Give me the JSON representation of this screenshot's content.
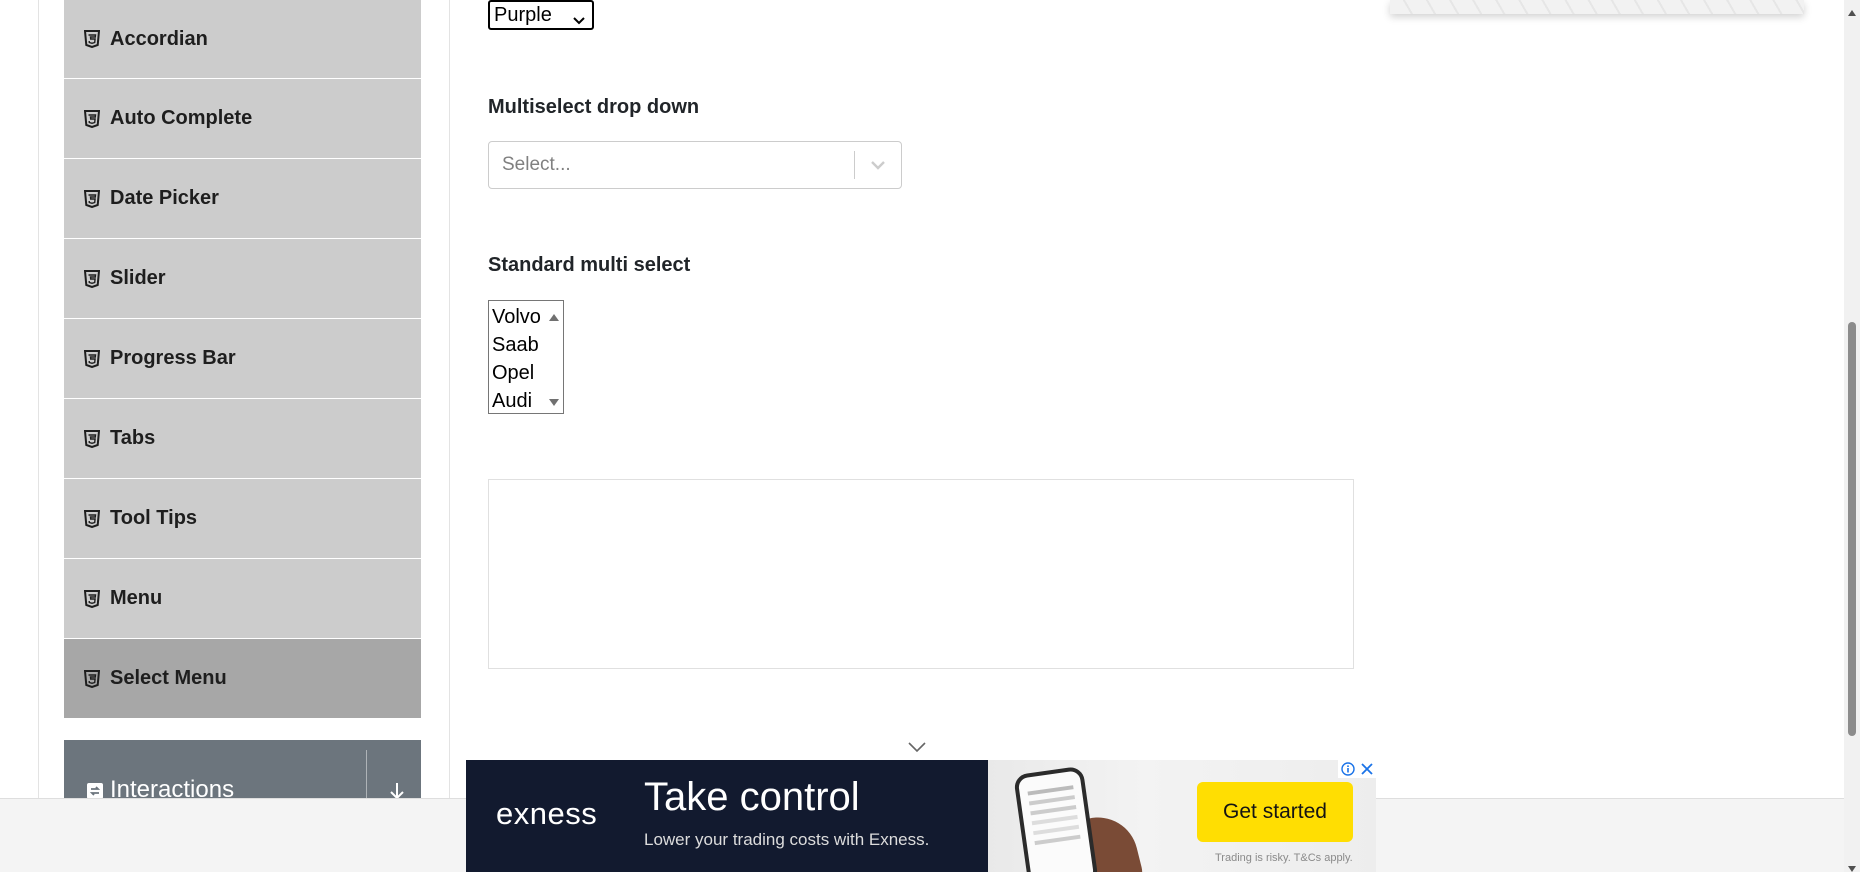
{
  "sidebar": {
    "items": [
      {
        "label": "Accordian",
        "icon": "html5-icon"
      },
      {
        "label": "Auto Complete",
        "icon": "html5-icon"
      },
      {
        "label": "Date Picker",
        "icon": "html5-icon"
      },
      {
        "label": "Slider",
        "icon": "html5-icon"
      },
      {
        "label": "Progress Bar",
        "icon": "html5-icon"
      },
      {
        "label": "Tabs",
        "icon": "html5-icon"
      },
      {
        "label": "Tool Tips",
        "icon": "html5-icon"
      },
      {
        "label": "Menu",
        "icon": "html5-icon"
      },
      {
        "label": "Select Menu",
        "icon": "html5-icon",
        "active": true
      }
    ],
    "group": {
      "label": "Interactions",
      "icon": "interactions-icon",
      "toggle_icon": "arrow-down-icon"
    }
  },
  "main": {
    "old_select": {
      "value": "Purple"
    },
    "multiselect": {
      "title": "Multiselect drop down",
      "placeholder": "Select..."
    },
    "standard_multi": {
      "title": "Standard multi select",
      "options": [
        "Volvo",
        "Saab",
        "Opel",
        "Audi"
      ]
    }
  },
  "banner_ad": {
    "brand": "exness",
    "headline": "Take control",
    "subline": "Lower your trading costs with Exness.",
    "cta": "Get started",
    "disclaimer": "Trading is risky. T&Cs apply."
  },
  "colors": {
    "menu_bg": "#cccccc",
    "menu_active_bg": "#a7a7a7",
    "group_bg": "#6c757d",
    "ad_bg": "#121a2f",
    "cta_bg": "#ffde02"
  }
}
